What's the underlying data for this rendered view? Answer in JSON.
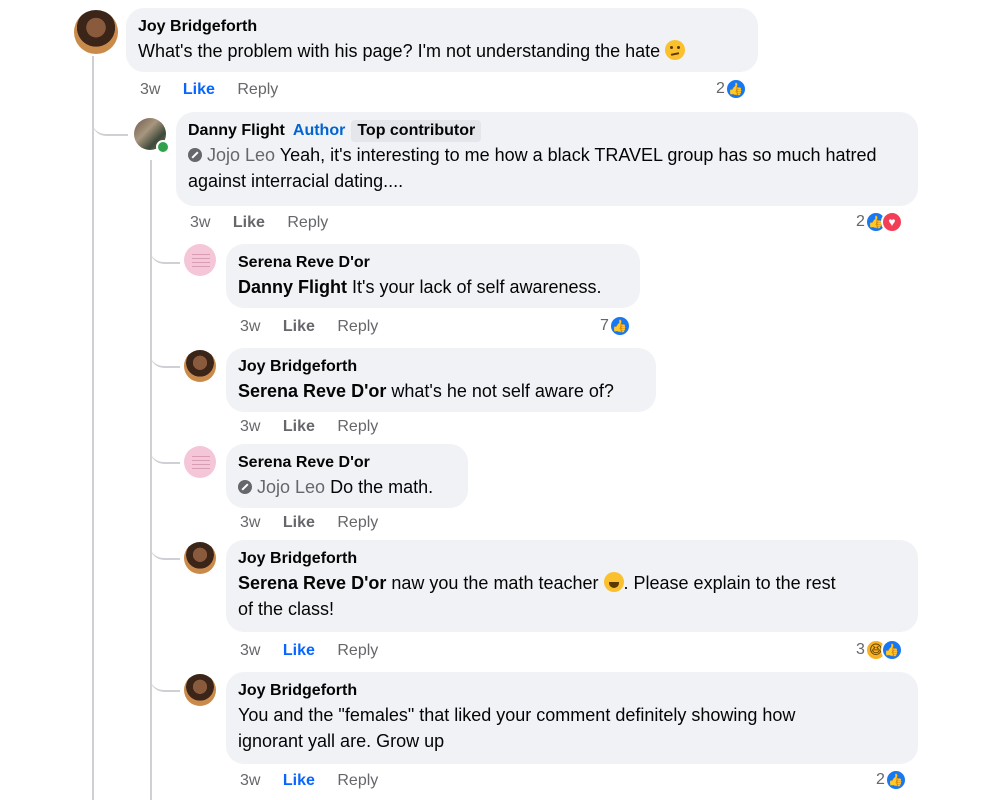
{
  "comments": [
    {
      "author": "Joy Bridgeforth",
      "text": "What's the problem with his page? I'm not understanding the hate",
      "emoji": "confused-face-icon",
      "time": "3w",
      "like_label": "Like",
      "reply_label": "Reply",
      "reactions_count": "2",
      "reactions": [
        "like"
      ],
      "liked": true
    },
    {
      "author": "Danny Flight",
      "author_badge": "Author",
      "contributor_badge": "Top contributor",
      "mention": "Jojo Leo",
      "text": "Yeah, it's interesting to me how a black TRAVEL group has so much hatred against interracial dating....",
      "time": "3w",
      "like_label": "Like",
      "reply_label": "Reply",
      "reactions_count": "2",
      "reactions": [
        "like",
        "love"
      ],
      "liked": false
    },
    {
      "author": "Serena Reve D'or",
      "mention": "Danny Flight",
      "text": "It's your lack of self awareness.",
      "time": "3w",
      "like_label": "Like",
      "reply_label": "Reply",
      "reactions_count": "7",
      "reactions": [
        "like"
      ],
      "liked": false
    },
    {
      "author": "Joy Bridgeforth",
      "mention": "Serena Reve D'or",
      "text": "what's he not self aware of?",
      "time": "3w",
      "like_label": "Like",
      "reply_label": "Reply",
      "liked": false
    },
    {
      "author": "Serena Reve D'or",
      "mention": "Jojo Leo",
      "text": "Do the math.",
      "time": "3w",
      "like_label": "Like",
      "reply_label": "Reply",
      "liked": false
    },
    {
      "author": "Joy Bridgeforth",
      "mention": "Serena Reve D'or",
      "text_a": "naw you the math teacher",
      "emoji": "rolling-laughing-icon",
      "text_b": ". Please explain to the rest",
      "text_c": "of the class!",
      "time": "3w",
      "like_label": "Like",
      "reply_label": "Reply",
      "reactions_count": "3",
      "reactions": [
        "haha",
        "like"
      ],
      "liked": true
    },
    {
      "author": "Joy Bridgeforth",
      "text_a": "You and the \"females\" that liked your comment definitely showing how",
      "text_b": "ignorant yall are. Grow up",
      "time": "3w",
      "like_label": "Like",
      "reply_label": "Reply",
      "reactions_count": "2",
      "reactions": [
        "like"
      ],
      "liked": true
    }
  ]
}
